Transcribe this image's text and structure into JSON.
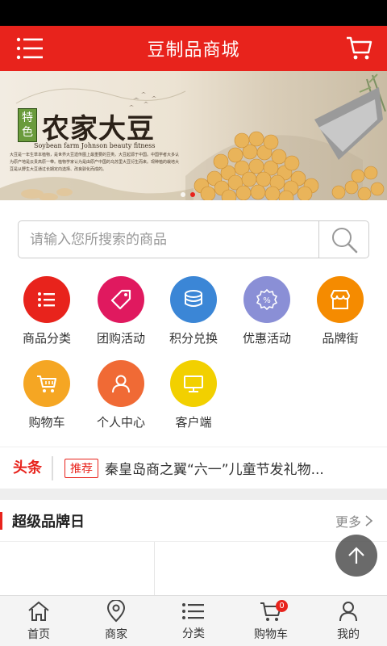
{
  "header": {
    "title": "豆制品商城",
    "menu_icon": "menu-icon",
    "cart_icon": "cart-icon"
  },
  "banner": {
    "badge": "特色",
    "title": "农家大豆",
    "subtitle": "Soybean farm Johnson beauty fitness",
    "description": "大豆是一年生草本植物，是世界大豆遗传图上最重要的豆类。大豆起源于中国。中国学者大多认为原产地是云贵高原一带。植物学家认为是由原产中国的乌苏里大豆衍生而来。现种植的栽培大豆是从野生大豆通过长期定向选择、改良驯化而成的。",
    "slides": 2,
    "active_slide": 2
  },
  "search": {
    "placeholder": "请输入您所搜索的商品",
    "icon": "search-icon"
  },
  "categories": [
    {
      "label": "商品分类",
      "icon": "list-icon",
      "color": "#e8231c"
    },
    {
      "label": "团购活动",
      "icon": "tag-icon",
      "color": "#e0195f"
    },
    {
      "label": "积分兑换",
      "icon": "coins-icon",
      "color": "#3b86d6"
    },
    {
      "label": "优惠活动",
      "icon": "percent-icon",
      "color": "#8a8fd6"
    },
    {
      "label": "品牌街",
      "icon": "store-icon",
      "color": "#f58b00"
    },
    {
      "label": "购物车",
      "icon": "cart-icon",
      "color": "#f5a623"
    },
    {
      "label": "个人中心",
      "icon": "user-icon",
      "color": "#f06a35"
    },
    {
      "label": "客户端",
      "icon": "monitor-icon",
      "color": "#f2d000"
    }
  ],
  "news": {
    "tag": "头条",
    "badge": "推荐",
    "headline": "秦皇岛商之翼“六一”儿童节发礼物..."
  },
  "section": {
    "title": "超级品牌日",
    "more": "更多",
    "more_icon": "chevron-right-icon"
  },
  "float_button": {
    "icon": "arrow-up-icon"
  },
  "bottom_nav": [
    {
      "label": "首页",
      "icon": "home-icon"
    },
    {
      "label": "商家",
      "icon": "location-icon"
    },
    {
      "label": "分类",
      "icon": "list-icon"
    },
    {
      "label": "购物车",
      "icon": "cart-icon",
      "badge": "0"
    },
    {
      "label": "我的",
      "icon": "user-icon"
    }
  ],
  "colors": {
    "brand_red": "#e8231c",
    "status_bar": "#000000",
    "nav_bg": "#f4f4f4"
  }
}
